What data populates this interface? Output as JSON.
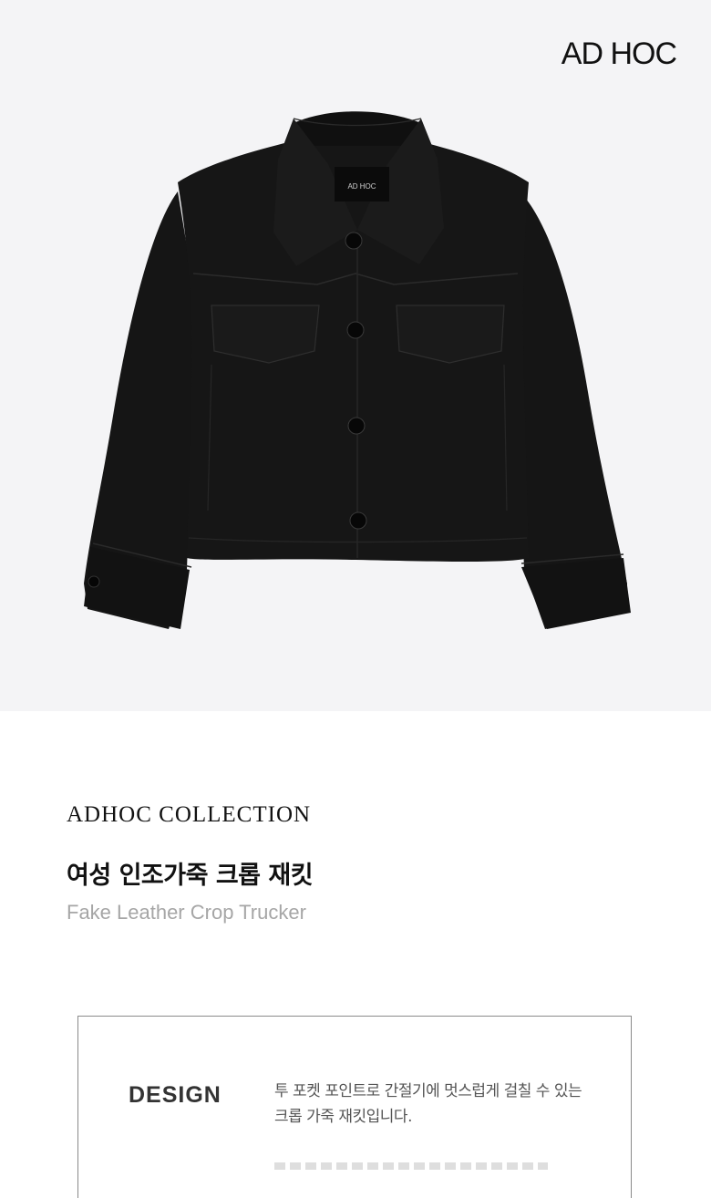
{
  "brand": {
    "logo": "AD HOC",
    "label_text": "AD HOC"
  },
  "product": {
    "collection": "ADHOC COLLECTION",
    "name_ko": "여성 인조가죽 크롭 재킷",
    "name_en": "Fake Leather Crop Trucker"
  },
  "design": {
    "label": "DESIGN",
    "text": "투 포켓 포인트로 간절기에 멋스럽게 걸칠 수 있는 크롭 가죽 재킷입니다."
  },
  "colors": {
    "hero_bg": "#f4f4f6",
    "jacket": "#141414",
    "muted_text": "#a6a6a6"
  }
}
